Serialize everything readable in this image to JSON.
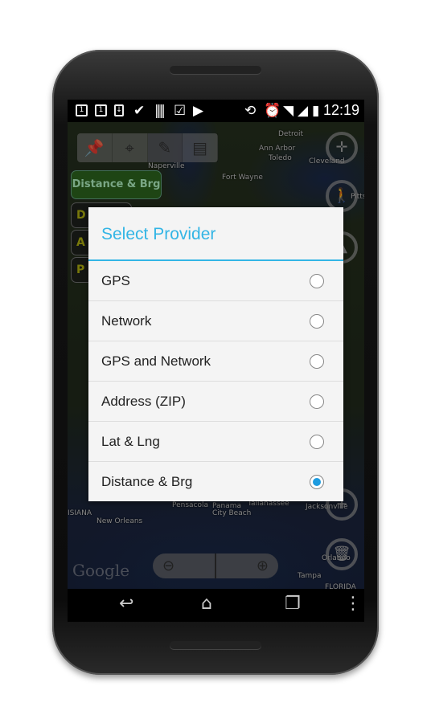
{
  "status": {
    "time": "12:19",
    "icons": [
      "sim1-icon",
      "sim1-icon",
      "download-icon",
      "check-icon",
      "barcode-icon",
      "clipboard-icon",
      "play-store-icon",
      "rotate-icon",
      "alarm-icon",
      "wifi-icon",
      "signal-icon",
      "battery-charging-icon"
    ]
  },
  "map": {
    "labels": [
      "Detroit",
      "Ann Arbor",
      "Toledo",
      "Cleveland",
      "Naperville",
      "Fort Wayne",
      "Pitts",
      "ISIANA",
      "New Orleans",
      "Pensacola",
      "Panama City Beach",
      "Tallahassee",
      "Jacksonville",
      "Tampa",
      "Orlando",
      "FLORIDA"
    ],
    "logo": "Google"
  },
  "toolbar": {
    "items": [
      "pin-icon",
      "crosshair-icon",
      "pencil-icon",
      "comment-icon"
    ],
    "selected": "pencil-icon"
  },
  "provider_button": "Distance & Brg",
  "mini_buttons": [
    "D",
    "A",
    "P"
  ],
  "dialog": {
    "title": "Select Provider",
    "options": [
      {
        "label": "GPS",
        "selected": false
      },
      {
        "label": "Network",
        "selected": false
      },
      {
        "label": "GPS and Network",
        "selected": false
      },
      {
        "label": "Address (ZIP)",
        "selected": false
      },
      {
        "label": "Lat & Lng",
        "selected": false
      },
      {
        "label": "Distance & Brg",
        "selected": true
      }
    ],
    "accent": "#33b5e5",
    "radio_color": "#1e9ce0"
  }
}
